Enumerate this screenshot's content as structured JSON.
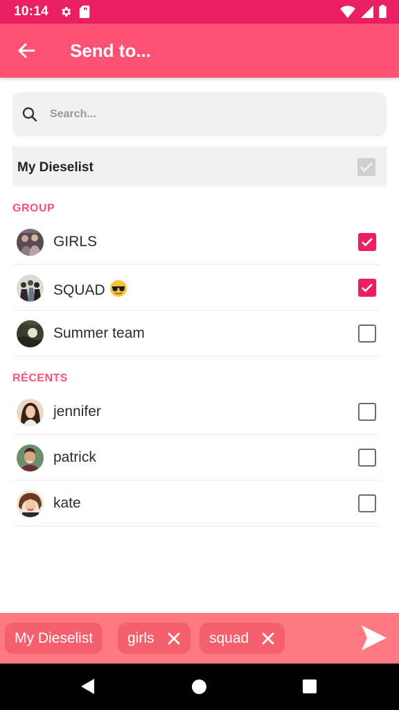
{
  "status_bar": {
    "time": "10:14"
  },
  "app_bar": {
    "title": "Send to..."
  },
  "search": {
    "placeholder": "Search..."
  },
  "list": {
    "label": "My Dieselist",
    "checked": true
  },
  "sections": {
    "group": {
      "title": "GROUP",
      "items": [
        {
          "name": "GIRLS",
          "checked": true,
          "avatar": "group-girls-avatar"
        },
        {
          "name": "SQUAD",
          "emoji": "sunglasses-emoji",
          "checked": true,
          "avatar": "group-squad-avatar"
        },
        {
          "name": "Summer team",
          "checked": false,
          "avatar": "group-summer-avatar"
        }
      ]
    },
    "recents": {
      "title": "RÉCENTS",
      "items": [
        {
          "name": "jennifer",
          "checked": false,
          "avatar": "jennifer-avatar"
        },
        {
          "name": "patrick",
          "checked": false,
          "avatar": "patrick-avatar"
        },
        {
          "name": "kate",
          "checked": false,
          "avatar": "kate-avatar"
        }
      ]
    }
  },
  "selected_chips": [
    {
      "label": "My Dieselist",
      "removable": false
    },
    {
      "label": "girls",
      "removable": true
    },
    {
      "label": "squad",
      "removable": true
    }
  ],
  "colors": {
    "status_bar": "#e91e63",
    "app_bar": "#ff5175",
    "accent": "#ec1e64",
    "bottom_bar": "#ff7982",
    "chip": "#f5606e"
  }
}
